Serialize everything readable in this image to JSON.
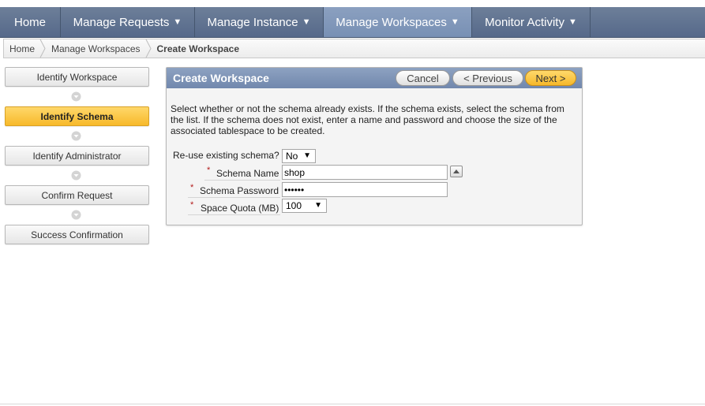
{
  "nav": {
    "items": [
      {
        "label": "Home",
        "has_menu": false
      },
      {
        "label": "Manage Requests",
        "has_menu": true
      },
      {
        "label": "Manage Instance",
        "has_menu": true
      },
      {
        "label": "Manage Workspaces",
        "has_menu": true,
        "active": true
      },
      {
        "label": "Monitor Activity",
        "has_menu": true
      }
    ],
    "caret": "▼"
  },
  "breadcrumb": {
    "items": [
      "Home",
      "Manage Workspaces",
      "Create Workspace"
    ]
  },
  "wizard": {
    "steps": [
      {
        "label": "Identify Workspace",
        "current": false
      },
      {
        "label": "Identify Schema",
        "current": true
      },
      {
        "label": "Identify Administrator",
        "current": false
      },
      {
        "label": "Confirm Request",
        "current": false
      },
      {
        "label": "Success Confirmation",
        "current": false
      }
    ]
  },
  "region": {
    "title": "Create Workspace",
    "buttons": {
      "cancel": "Cancel",
      "previous": "< Previous",
      "next": "Next >"
    },
    "instructions": "Select whether or not the schema already exists. If the schema exists, select the schema from the list. If the schema does not exist, enter a name and password and choose the size of the associated tablespace to be created."
  },
  "form": {
    "reuse_label": "Re-use existing schema?",
    "reuse_value": "No",
    "schema_name_label": "Schema Name",
    "schema_name_value": "shop",
    "schema_password_label": "Schema Password",
    "schema_password_value": "••••••",
    "space_quota_label": "Space Quota (MB)",
    "space_quota_value": "100",
    "required_marker": "*"
  },
  "colors": {
    "nav_bg": "#5f7291",
    "nav_active": "#8196b8",
    "region_header": "#7f95b8",
    "current_step": "#f9c33e",
    "required": "#b21a1a"
  }
}
